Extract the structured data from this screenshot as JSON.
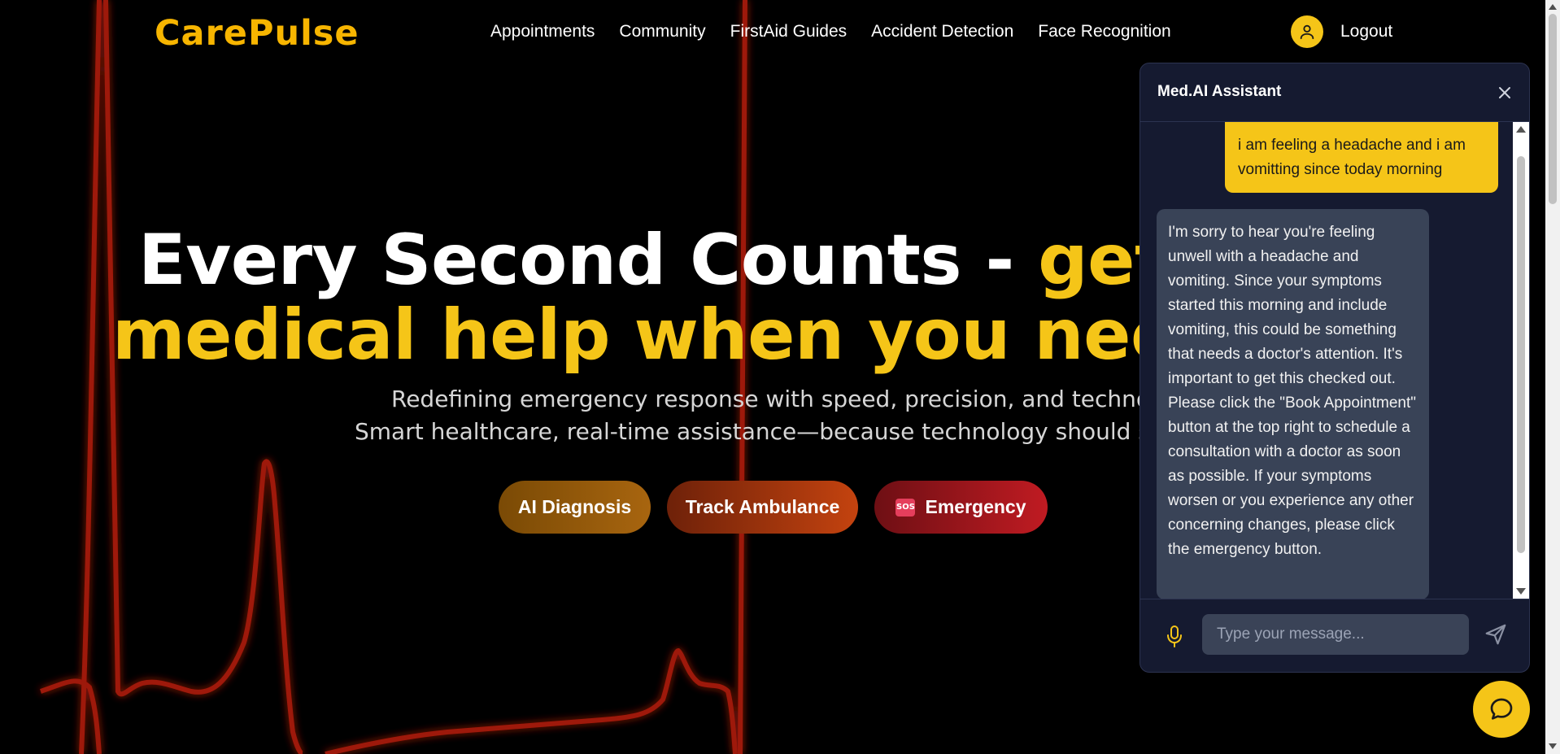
{
  "brand": {
    "logo": "CarePulse",
    "accent": "#f5c518"
  },
  "nav": {
    "links": [
      "Appointments",
      "Community",
      "FirstAid Guides",
      "Accident Detection",
      "Face Recognition"
    ],
    "profile_icon": "user-icon",
    "logout": "Logout"
  },
  "hero": {
    "title_white": "Every Second Counts - ",
    "title_yellow": "get the",
    "title_line2": "medical help when you need it",
    "subtitle1": "Redefining emergency response with speed, precision, and technology.",
    "subtitle2": "Smart healthcare, real-time assistance—because technology should save lives.",
    "buttons": {
      "ai": "AI Diagnosis",
      "track": "Track Ambulance",
      "emergency": "Emergency",
      "sos_badge": "SOS"
    }
  },
  "chat": {
    "title": "Med.AI Assistant",
    "messages": [
      {
        "role": "user",
        "text": "i am feeling a headache and i am vomitting since today morning"
      },
      {
        "role": "assistant",
        "text": "I'm sorry to hear you're feeling unwell with a headache and vomiting. Since your symptoms started this morning and include vomiting, this could be something that needs a doctor's attention. It's important to get this checked out. Please click the \"Book Appointment\" button at the top right to schedule a consultation with a doctor as soon as possible. If your symptoms worsen or you experience any other concerning changes, please click the emergency button."
      }
    ],
    "input_placeholder": "Type your message...",
    "mic_icon": "mic-icon",
    "send_icon": "send-icon",
    "close_icon": "close-icon"
  },
  "fab": {
    "icon": "chat-bubble-icon"
  }
}
